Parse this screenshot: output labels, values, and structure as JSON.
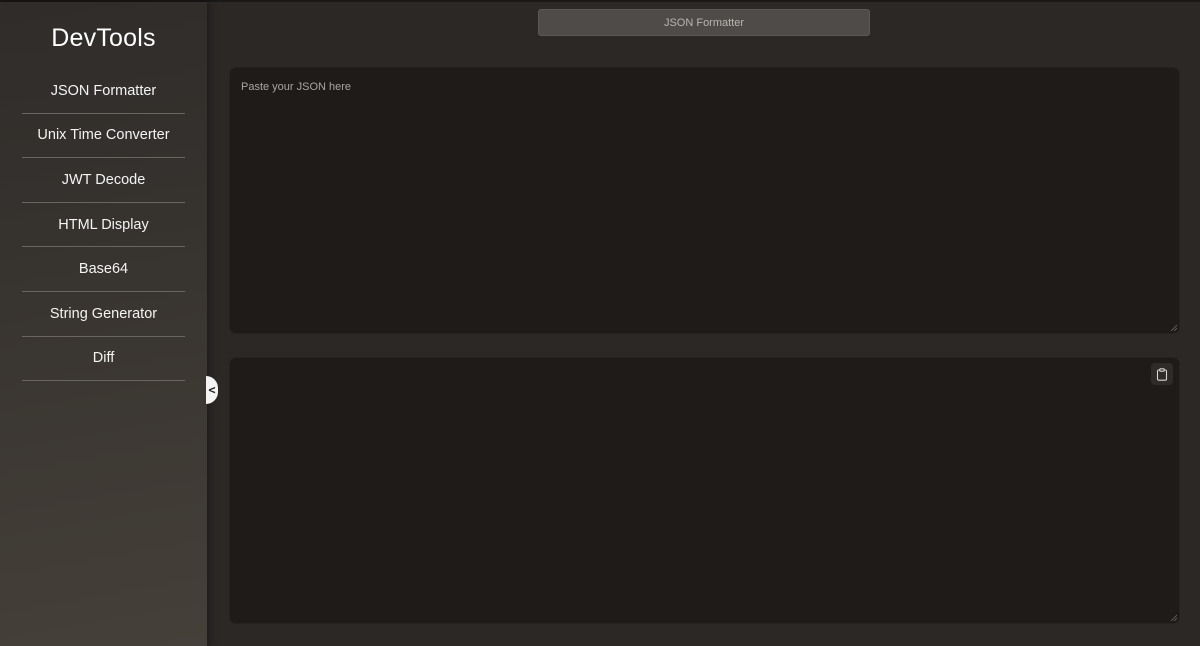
{
  "app": {
    "title": "DevTools"
  },
  "sidebar": {
    "items": [
      {
        "label": "JSON Formatter"
      },
      {
        "label": "Unix Time Converter"
      },
      {
        "label": "JWT Decode"
      },
      {
        "label": "HTML Display"
      },
      {
        "label": "Base64"
      },
      {
        "label": "String Generator"
      },
      {
        "label": "Diff"
      }
    ],
    "collapse_label": "<"
  },
  "header": {
    "tool_title": "JSON Formatter"
  },
  "input": {
    "placeholder": "Paste your JSON here",
    "value": ""
  },
  "output": {
    "value": "",
    "copy_icon": "clipboard-icon"
  },
  "colors": {
    "background": "#2b2826",
    "panel": "#1e1b19",
    "title_button": "#4e4b48"
  }
}
